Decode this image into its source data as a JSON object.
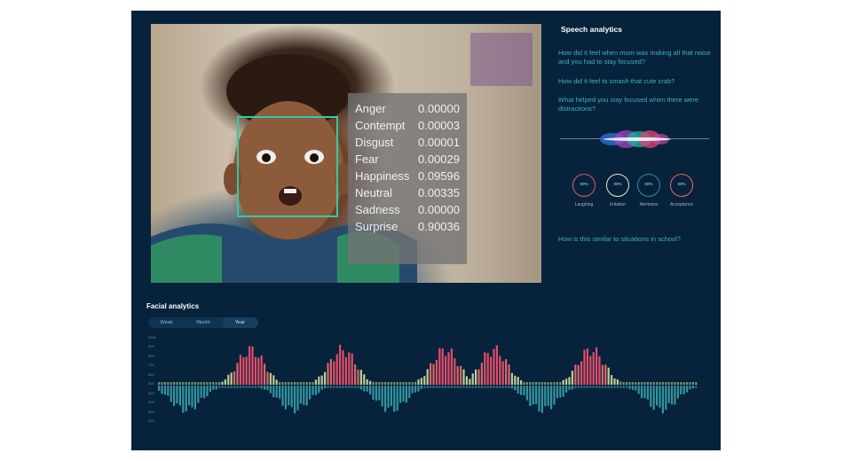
{
  "emotions": [
    {
      "label": "Anger",
      "value": "0.00000"
    },
    {
      "label": "Contempt",
      "value": "0.00003"
    },
    {
      "label": "Disgust",
      "value": "0.00001"
    },
    {
      "label": "Fear",
      "value": "0.00029"
    },
    {
      "label": "Happiness",
      "value": "0.09596"
    },
    {
      "label": "Neutral",
      "value": "0.00335"
    },
    {
      "label": "Sadness",
      "value": "0.00000"
    },
    {
      "label": "Surprise",
      "value": "0.90036"
    }
  ],
  "speech": {
    "title": "Speech analytics",
    "questions": [
      "How did it feel when mom was making all that noise and you had to stay focused?",
      "How did it feel to smash that cute crab?",
      "What helped you stay focused when there were distractions?"
    ],
    "followup": "How is this similar to situations in school?",
    "metrics": [
      {
        "label": "Laughing",
        "value": "00%",
        "color": "#e05a6e"
      },
      {
        "label": "Irritation",
        "value": "00%",
        "color": "#f0e6c8"
      },
      {
        "label": "Alertness",
        "value": "00%",
        "color": "#2a8fa0"
      },
      {
        "label": "Acceptance",
        "value": "00%",
        "color": "#e07060"
      }
    ]
  },
  "facial": {
    "title": "Facial analytics",
    "periods": [
      "Week",
      "Month",
      "Year"
    ],
    "selected_period": "Year",
    "y_ticks": [
      "1000",
      "900",
      "800",
      "700",
      "600",
      "500",
      "400",
      "300",
      "200",
      "100"
    ]
  },
  "colors": {
    "panel": "#07223b",
    "face_box": "#35c9a8",
    "accent_red": "#e6485a",
    "accent_teal": "#3aa9b2",
    "question_text": "#37b5c0"
  }
}
